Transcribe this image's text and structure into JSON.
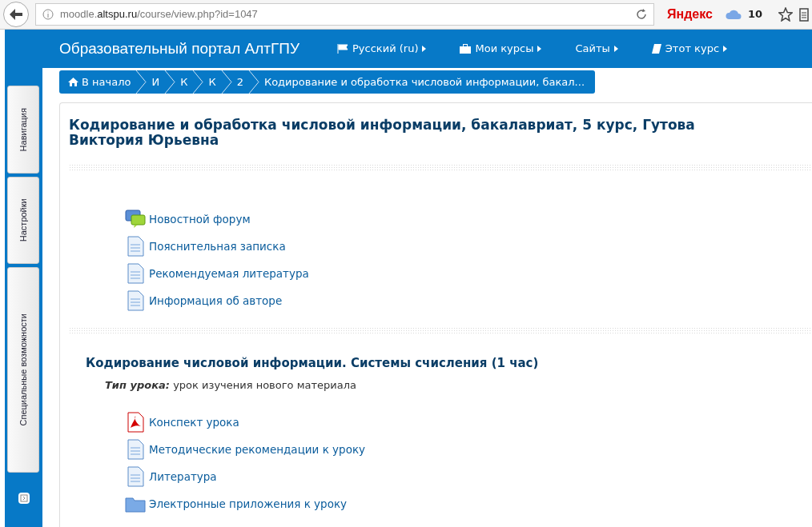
{
  "browser": {
    "url_host": "moodle.",
    "url_domain": "altspu.ru",
    "url_path": "/course/view.php?id=1047",
    "yandex": "Яндекс",
    "weather": "10"
  },
  "navbar": {
    "brand": "Образовательный портал АлтГПУ",
    "menus": [
      {
        "kind": "flag",
        "label": "Русский (ru)"
      },
      {
        "kind": "briefcase",
        "label": "Мои курсы"
      },
      {
        "kind": "none",
        "label": "Сайты"
      },
      {
        "kind": "book",
        "label": "Этот курс"
      }
    ]
  },
  "breadcrumb": [
    {
      "kind": "home",
      "label": "В начало"
    },
    {
      "kind": "text",
      "label": "И"
    },
    {
      "kind": "text",
      "label": "К"
    },
    {
      "kind": "text",
      "label": "К"
    },
    {
      "kind": "text",
      "label": "2"
    },
    {
      "kind": "text",
      "label": "Кодирование и обработка числовой информации, бакал..."
    }
  ],
  "side_tabs": [
    "Навигация",
    "Настройки",
    "Специальные возможности"
  ],
  "course_title": "Кодирование и обработка числовой информации, бакалавриат, 5 курс, Гутова Виктория Юрьевна",
  "sections": [
    {
      "activities": [
        {
          "kind": "forum",
          "label": "Новостной форум"
        },
        {
          "kind": "page",
          "label": "Пояснительная записка"
        },
        {
          "kind": "page",
          "label": "Рекомендуемая литература"
        },
        {
          "kind": "page",
          "label": "Информация об авторе"
        }
      ]
    },
    {
      "title": "Кодирование числовой информации. Системы счисления (1 час)",
      "summary": "**Тип урока:** урок изучения нового материала",
      "activities": [
        {
          "kind": "pdf",
          "label": "Конспект урока"
        },
        {
          "kind": "page",
          "label": "Методические рекомендации к уроку"
        },
        {
          "kind": "page",
          "label": "Литература"
        },
        {
          "kind": "folder",
          "label": "Электронные приложения к уроку"
        }
      ]
    }
  ]
}
